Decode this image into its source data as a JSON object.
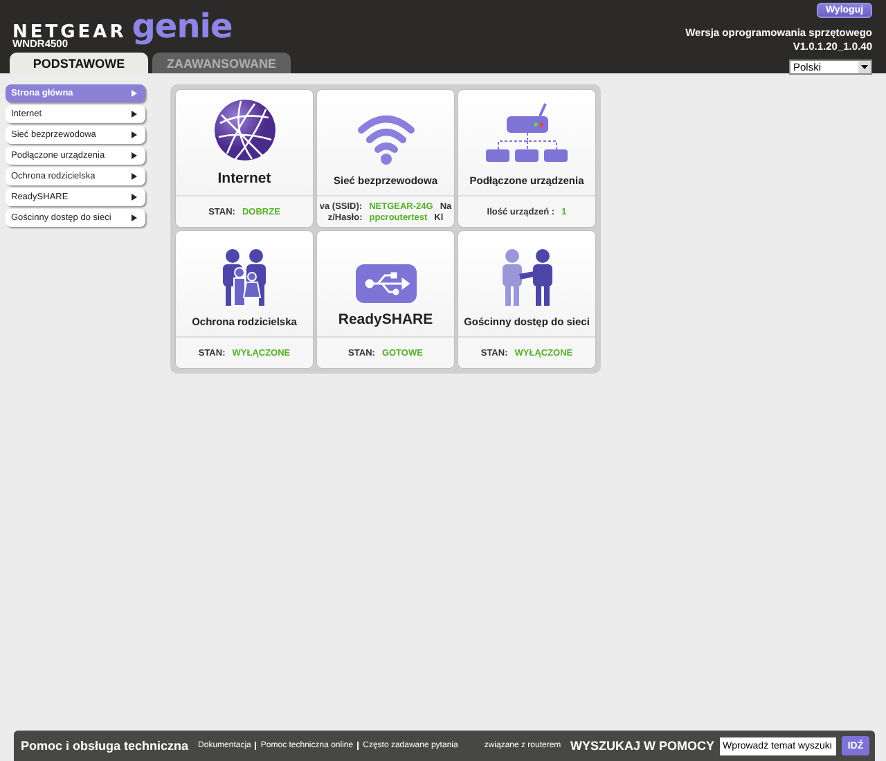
{
  "header": {
    "brand": "NETGEAR",
    "product": "genie",
    "model": "WNDR4500",
    "logout_button": "Wyloguj",
    "firmware_label": "Wersja oprogramowania sprzętowego",
    "firmware_version": "V1.0.1.20_1.0.40",
    "language": "Polski"
  },
  "tabs": [
    {
      "label": "PODSTAWOWE",
      "selected": true
    },
    {
      "label": "ZAAWANSOWANE",
      "selected": false
    }
  ],
  "sidebar": {
    "items": [
      {
        "label": "Strona główna",
        "selected": true
      },
      {
        "label": "Internet",
        "selected": false
      },
      {
        "label": "Sieć bezprzewodowa",
        "selected": false
      },
      {
        "label": "Podłączone urządzenia",
        "selected": false
      },
      {
        "label": "Ochrona rodzicielska",
        "selected": false
      },
      {
        "label": "ReadySHARE",
        "selected": false
      },
      {
        "label": "Gościnny dostęp do sieci",
        "selected": false
      }
    ]
  },
  "tiles": [
    {
      "title": "Internet",
      "kind": "globe",
      "large": true,
      "status": [
        {
          "label": "STAN:",
          "value": "DOBRZE"
        }
      ]
    },
    {
      "title": "Sieć bezprzewodowa",
      "kind": "wifi",
      "large": false,
      "status": [
        {
          "label": "va (SSID):",
          "value": "NETGEAR-24G",
          "tail": "Na"
        },
        {
          "label": "z/Hasło:",
          "value": "ppcroutertest",
          "tail": "Kl"
        }
      ]
    },
    {
      "title": "Podłączone urządzenia",
      "kind": "network",
      "large": false,
      "status": [
        {
          "label": "Ilość urządzeń :",
          "value": "1"
        }
      ]
    },
    {
      "title": "Ochrona rodzicielska",
      "kind": "family",
      "large": false,
      "status": [
        {
          "label": "STAN:",
          "value": "WYŁĄCZONE"
        }
      ]
    },
    {
      "title": "ReadySHARE",
      "kind": "usb",
      "large": true,
      "status": [
        {
          "label": "STAN:",
          "value": "GOTOWE"
        }
      ]
    },
    {
      "title": "Gościnny dostęp do sieci",
      "kind": "handshake",
      "large": false,
      "status": [
        {
          "label": "STAN:",
          "value": "WYŁĄCZONE"
        }
      ]
    }
  ],
  "footer": {
    "title": "Pomoc i obsługa techniczna",
    "links": [
      "Dokumentacja",
      "Pomoc techniczna online",
      "Często zadawane pytania"
    ],
    "note": "związane z routerem",
    "search_label": "WYSZUKAJ W POMOCY",
    "search_placeholder": "Wprowadź temat wyszuki",
    "search_button": "IDŹ"
  }
}
